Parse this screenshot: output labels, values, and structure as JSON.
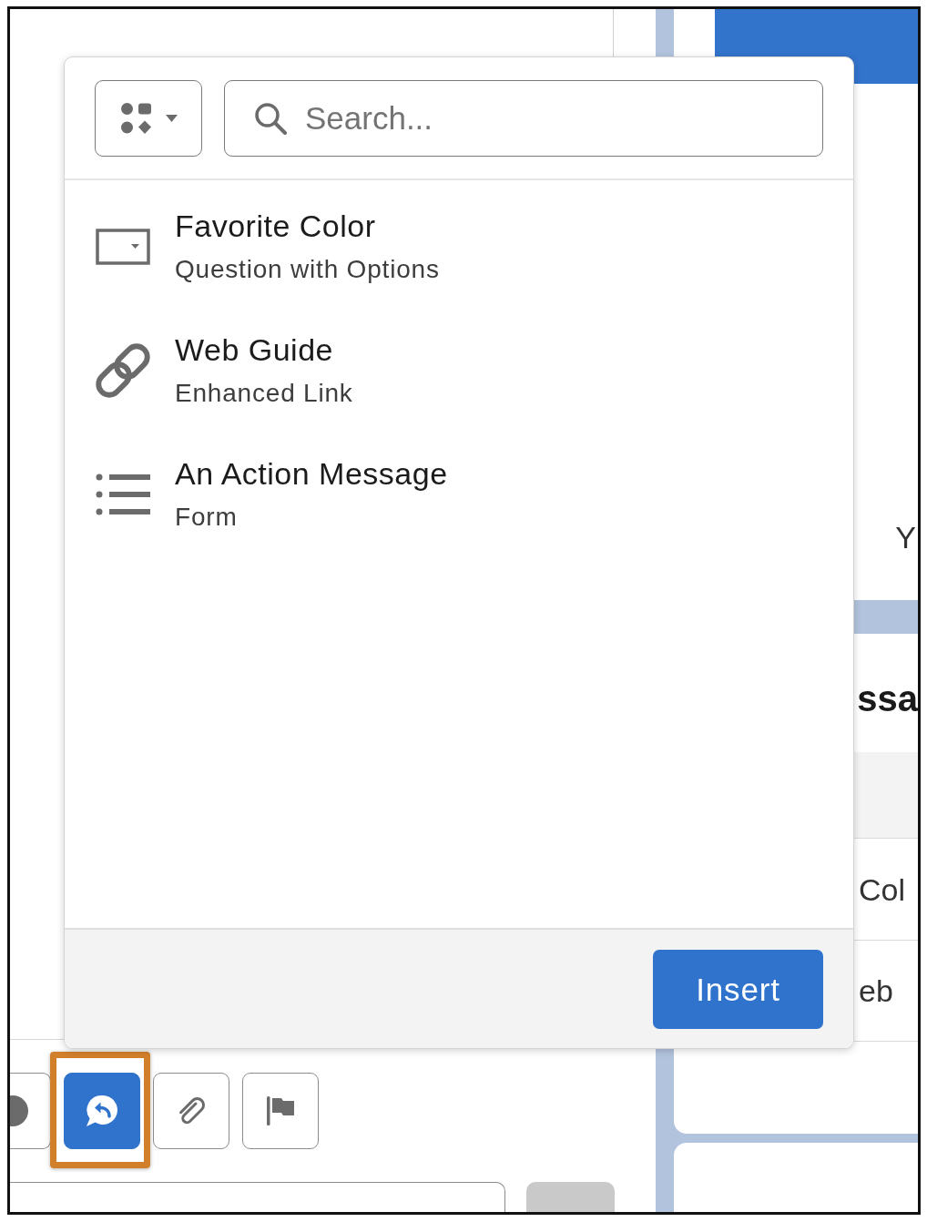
{
  "popover": {
    "search": {
      "placeholder": "Search..."
    },
    "items": [
      {
        "kind": "question",
        "title": "Favorite Color",
        "subtitle": "Question with Options",
        "selected": false
      },
      {
        "kind": "link",
        "title": "Web Guide",
        "subtitle": "Enhanced Link",
        "selected": false
      },
      {
        "kind": "form",
        "title": "An Action Message",
        "subtitle": "Form",
        "selected": false
      }
    ],
    "insert_button": "Insert"
  },
  "preview": {
    "top_card": {
      "text": "Y"
    },
    "lower_card": {
      "title": "ssa",
      "rows": [
        "Col",
        "eb"
      ]
    }
  },
  "toolbar": {
    "buttons": [
      {
        "selected": false,
        "highlighted": false
      },
      {
        "selected": true,
        "highlighted": true
      },
      {
        "selected": false,
        "highlighted": false
      },
      {
        "selected": false,
        "highlighted": false
      }
    ]
  }
}
